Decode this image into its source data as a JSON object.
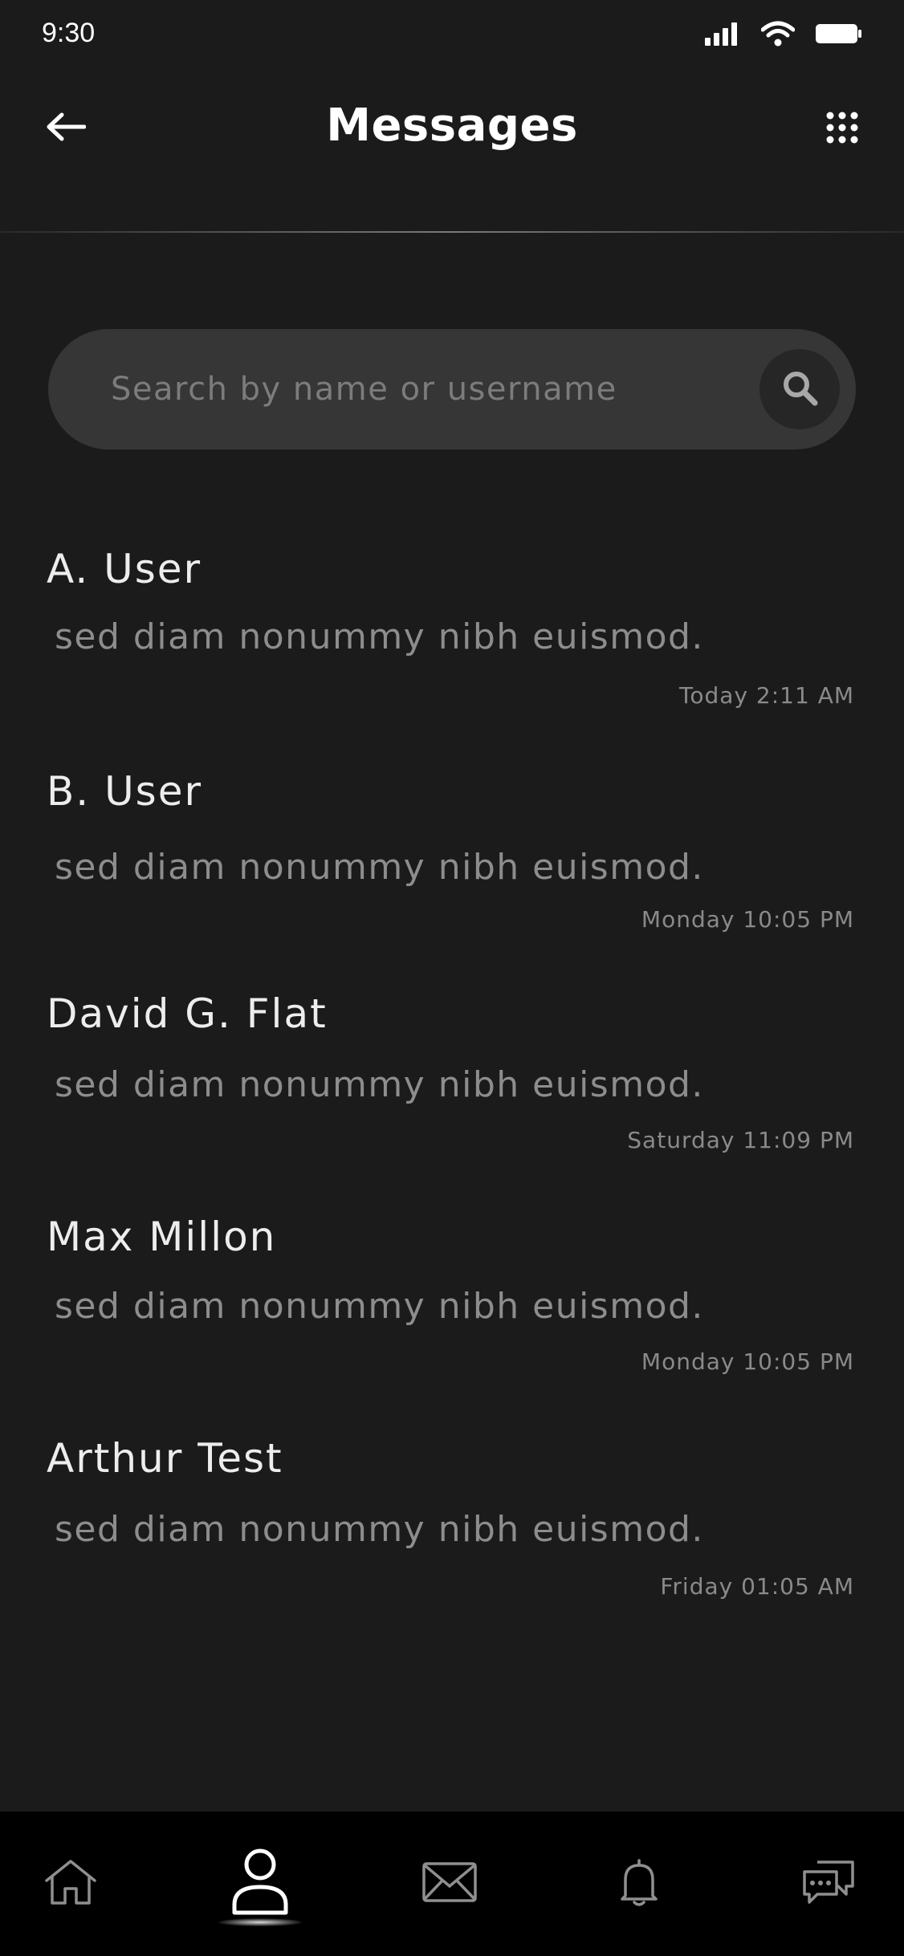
{
  "status_bar": {
    "time": "9:30",
    "icons": [
      "signal-icon",
      "wifi-icon",
      "battery-icon"
    ]
  },
  "header": {
    "title": "Messages",
    "back_icon": "arrow-left-icon",
    "menu_icon": "grid-dots-icon"
  },
  "search": {
    "placeholder": "Search by name or username",
    "value": "",
    "icon": "search-icon"
  },
  "messages": [
    {
      "name": "A. User",
      "preview": "sed diam nonummy nibh euismod.",
      "time": "Today 2:11 AM"
    },
    {
      "name": "B. User",
      "preview": "sed diam nonummy nibh euismod.",
      "time": "Monday 10:05 PM"
    },
    {
      "name": "David G. Flat",
      "preview": "sed diam nonummy nibh euismod.",
      "time": "Saturday 11:09 PM"
    },
    {
      "name": "Max Millon",
      "preview": "sed diam nonummy nibh euismod.",
      "time": "Monday 10:05 PM"
    },
    {
      "name": "Arthur Test",
      "preview": "sed diam nonummy nibh euismod.",
      "time": "Friday 01:05 AM"
    }
  ],
  "bottom_nav": {
    "items": [
      "home-icon",
      "profile-icon",
      "mail-icon",
      "bell-icon",
      "chat-icon"
    ],
    "active": "profile-icon"
  },
  "colors": {
    "background": "#1b1b1b",
    "search_bg": "#363636",
    "nav_bg": "#000000",
    "text_primary": "#ededed",
    "text_secondary": "#8d8d8d"
  }
}
